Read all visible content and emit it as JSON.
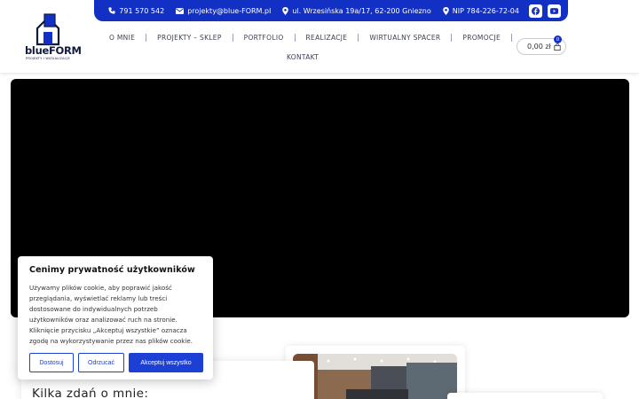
{
  "logo": {
    "text": "blueFORM",
    "subtitle": "PROJEKTY I WIZUALIZACJE"
  },
  "topbar": {
    "phone": "791 570 542",
    "email": "projekty@blue-FORM.pl",
    "address": "ul. Wrzesińska 19a/17, 62-200 Gniezno",
    "nip": "NIP 784-226-72-04",
    "social": [
      "facebook-icon",
      "youtube-icon"
    ],
    "color": "#1230c4"
  },
  "nav": {
    "items": [
      "O MNIE",
      "PROJEKTY – SKLEP",
      "PORTFOLIO",
      "REALIZACJE",
      "WIRTUALNY SPACER",
      "PROMOCJE"
    ],
    "second_row": "KONTAKT"
  },
  "cart": {
    "amount": "0,00 zł",
    "count": "0"
  },
  "about": {
    "title": "Kilka zdań o mnie:"
  },
  "cookie": {
    "title": "Cenimy prywatność użytkowników",
    "text": "Używamy plików cookie, aby poprawić jakość przeglądania, wyświetlać reklamy lub treści dostosowane do indywidualnych potrzeb użytkowników oraz analizować ruch na stronie. Kliknięcie przycisku „Akceptuj wszystkie” oznacza zgodę na wykorzystywanie przez nas plików cookie.",
    "buttons": {
      "customize": "Dostosuj",
      "reject": "Odrzucać",
      "accept": "Akceptuj wszystko"
    },
    "accent": "#1c3fd4"
  }
}
